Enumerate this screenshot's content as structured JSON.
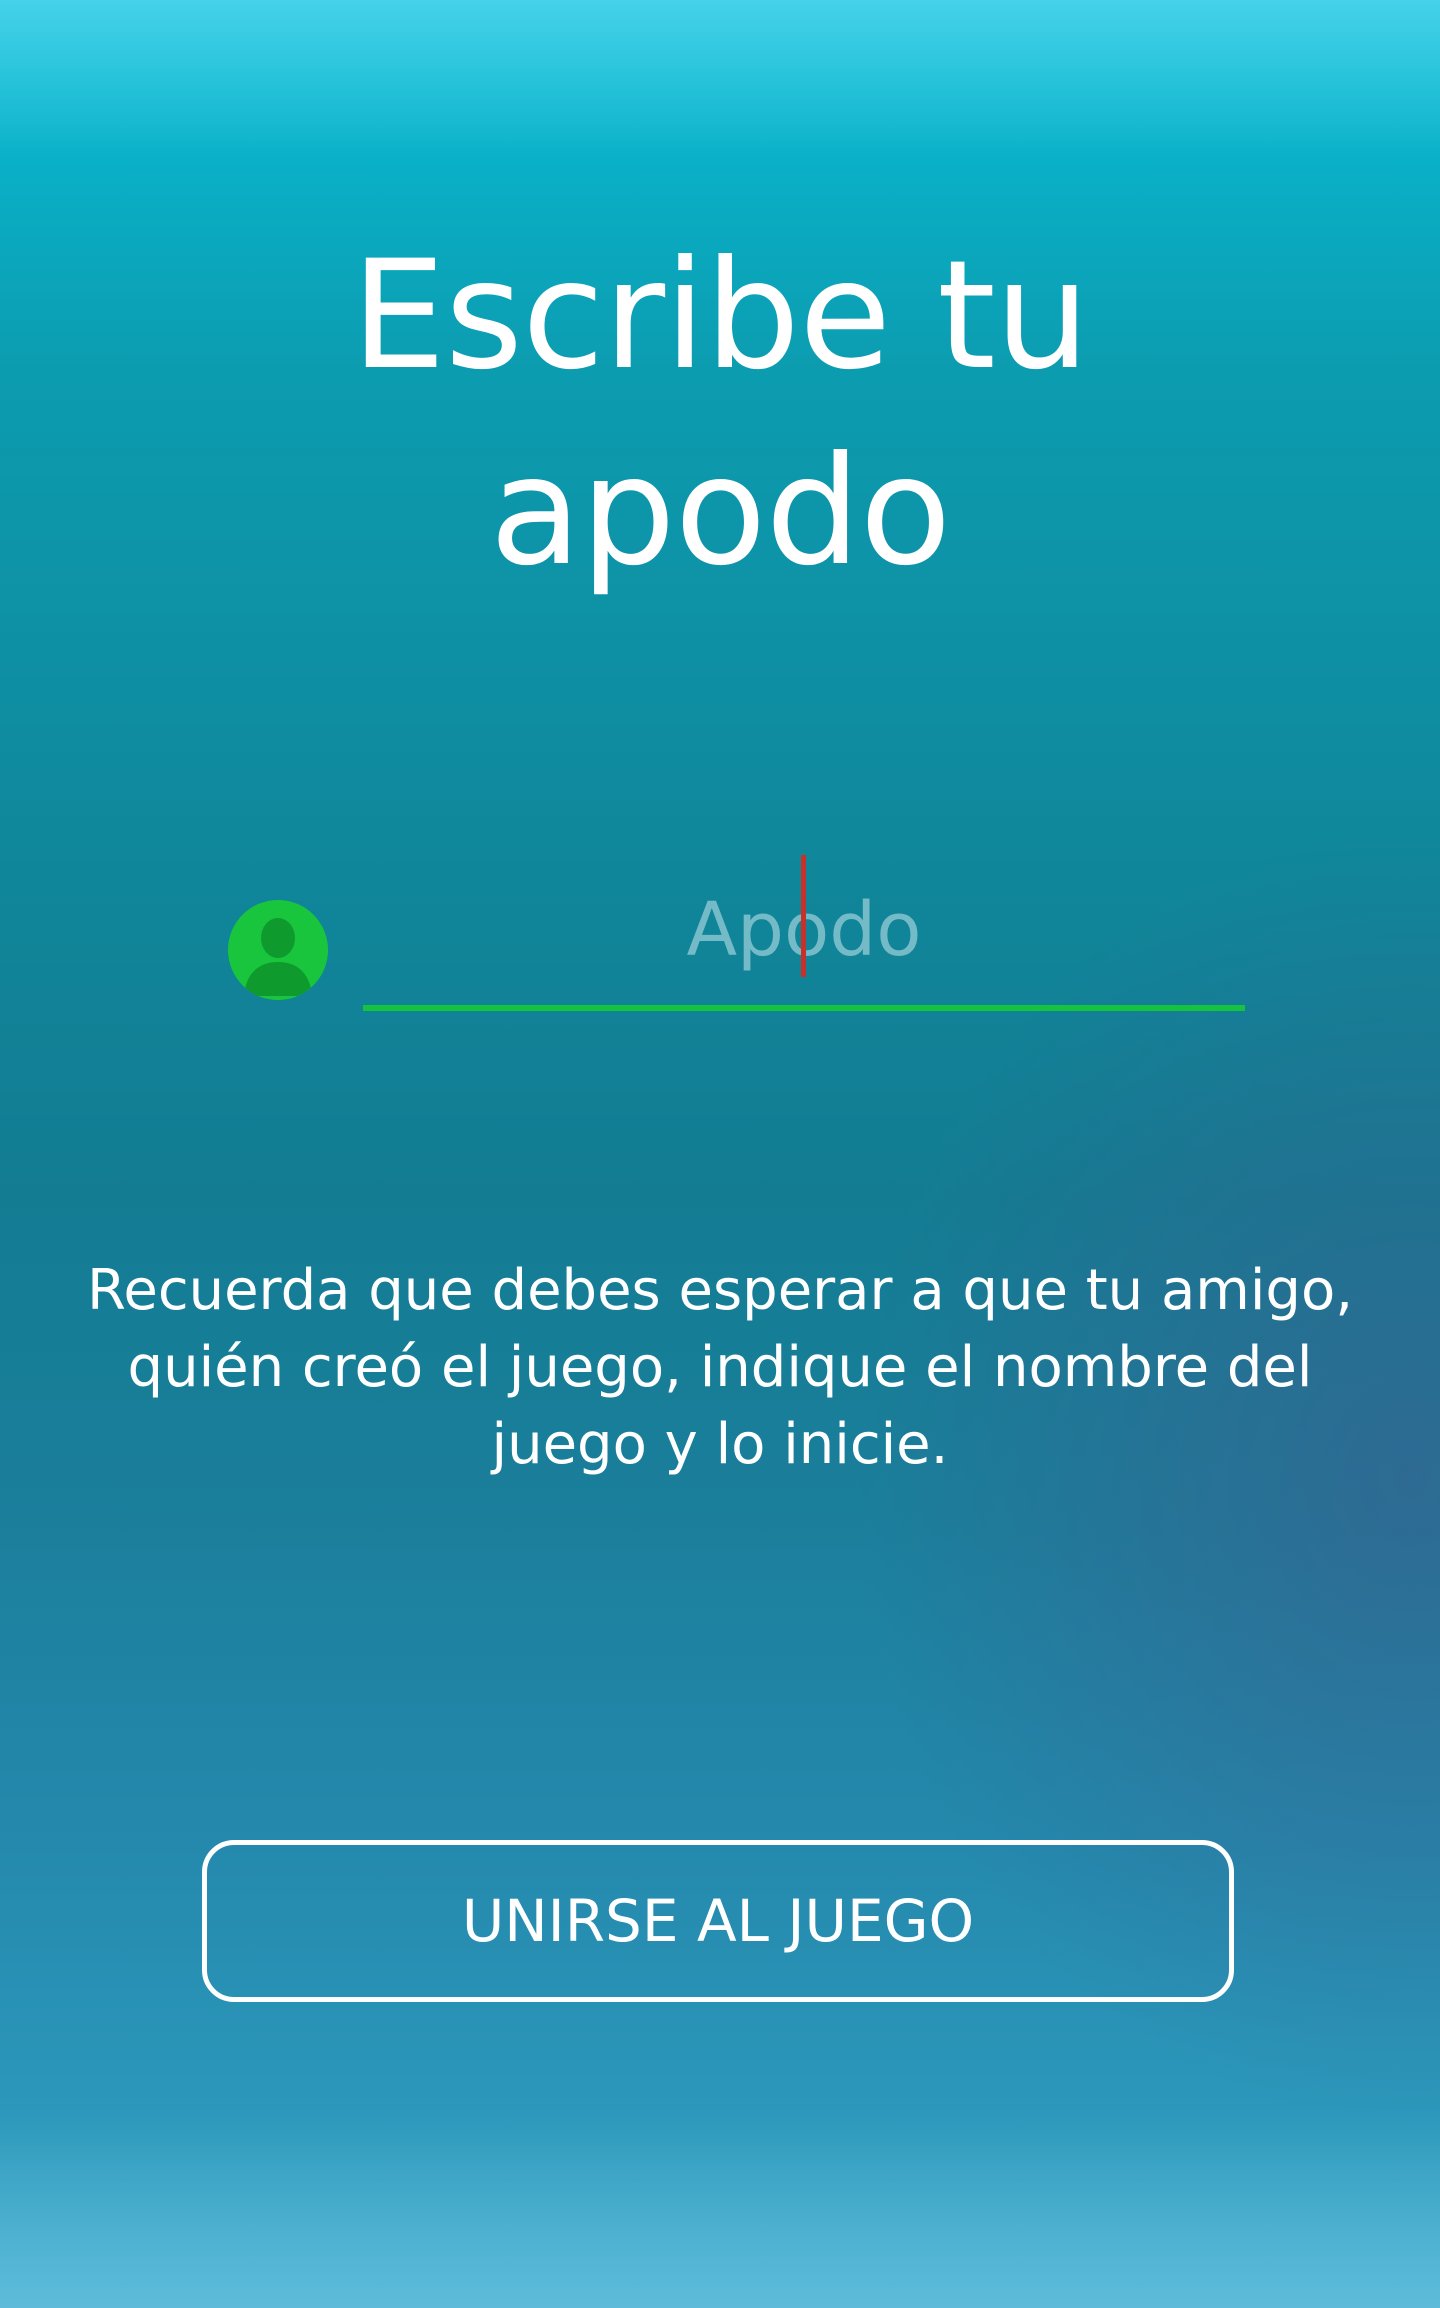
{
  "screen": {
    "title_line1": "Escribe tu",
    "title_line2": "apodo"
  },
  "nickname": {
    "icon": "user-icon",
    "placeholder": "Apodo",
    "value": ""
  },
  "hint": {
    "text": "Recuerda que debes esperar a que tu amigo, quién creó el juego, indique el nombre del juego y lo inicie."
  },
  "actions": {
    "join_label": "UNIRSE AL JUEGO"
  },
  "colors": {
    "accent": "#19c53c",
    "caret": "#c8302a",
    "background_top": "#07bfd9",
    "background_mid": "#137c93",
    "background_bottom": "#2c98bb",
    "text": "#ffffff"
  }
}
